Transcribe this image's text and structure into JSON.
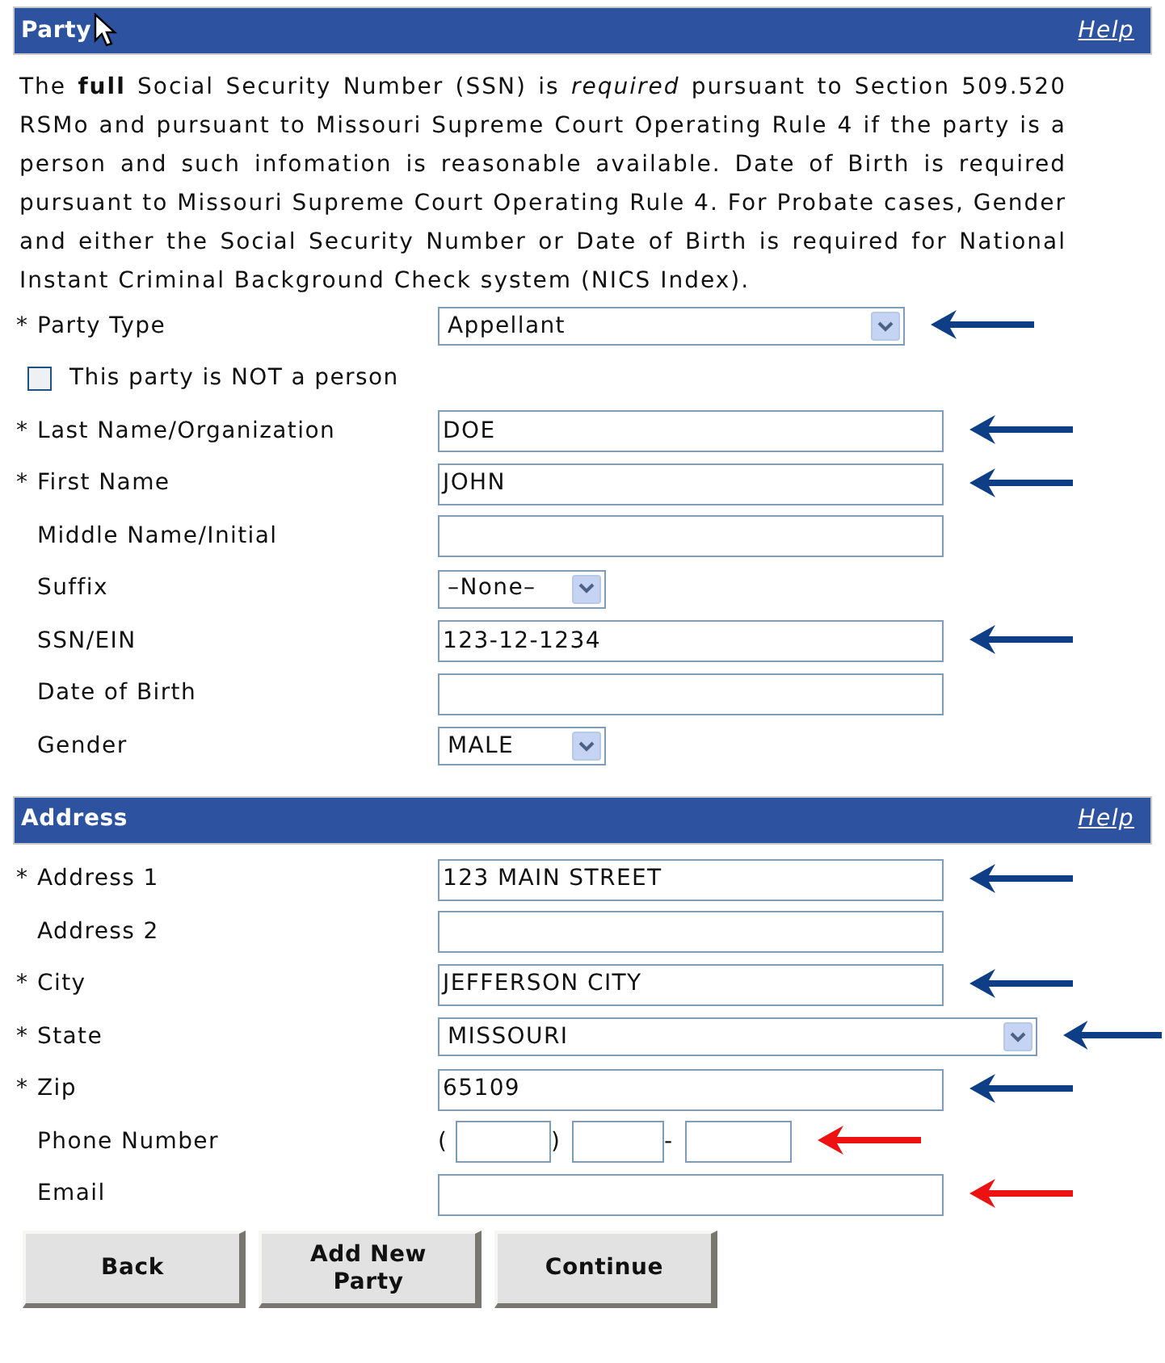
{
  "sections": [
    {
      "title": "Party",
      "help": "Help",
      "cursor": true,
      "intro": "The **full** Social Security Number (SSN) is *required* pursuant to Section 509.520 RSMo and pursuant to Missouri Supreme Court Operating Rule 4 if the party is a person and such infomation is reasonable available. Date of Birth is required pursuant to Missouri Supreme Court Operating Rule 4. For Probate cases, Gender and either the Social Security Number or Date of Birth is required for National Instant Criminal Background Check system (NICS Index).",
      "rows": [
        {
          "kind": "select",
          "marker": "*",
          "label": "Party Type",
          "value": "Appellant",
          "arrow": {
            "color": "#0d3e86"
          }
        },
        {
          "kind": "checkbox",
          "label": "This party is NOT a person",
          "checked": false
        },
        {
          "kind": "text",
          "marker": "*",
          "label": "Last Name/Organization",
          "value": "DOE",
          "arrow": {
            "color": "#0d3e86"
          }
        },
        {
          "kind": "text",
          "marker": "*",
          "label": "First Name",
          "value": "JOHN",
          "arrow": {
            "color": "#0d3e86"
          }
        },
        {
          "kind": "text",
          "label": "Middle Name/Initial"
        },
        {
          "kind": "short-select",
          "label": "Suffix",
          "value": "–None–"
        },
        {
          "kind": "text",
          "label": "SSN/EIN",
          "value": "123-12-1234",
          "arrow": {
            "color": "#0d3e86"
          }
        },
        {
          "kind": "text",
          "label": "Date of Birth"
        },
        {
          "kind": "short-select",
          "label": "Gender",
          "value": "MALE"
        }
      ]
    },
    {
      "title": "Address",
      "help": "Help",
      "cursor": false,
      "rows": [
        {
          "kind": "text",
          "marker": "*",
          "label": "Address 1",
          "value": "123 MAIN STREET",
          "arrow": {
            "color": "#0d3e86"
          }
        },
        {
          "kind": "text",
          "label": "Address 2"
        },
        {
          "kind": "text",
          "marker": "*",
          "label": "City",
          "value": "JEFFERSON CITY",
          "arrow": {
            "color": "#0d3e86"
          }
        },
        {
          "kind": "wide-select",
          "marker": "*",
          "label": "State",
          "value": "MISSOURI",
          "arrow": {
            "color": "#0d3e86"
          }
        },
        {
          "kind": "text",
          "marker": "*",
          "label": "Zip",
          "value": "65109",
          "arrow": {
            "color": "#0d3e86"
          }
        },
        {
          "kind": "phone",
          "label": "Phone Number",
          "open": "(",
          "close": ")",
          "dash": "-",
          "arrow": {
            "color": "#ee1111"
          }
        },
        {
          "kind": "text",
          "label": "Email",
          "arrow": {
            "color": "#ee1111"
          }
        }
      ]
    }
  ],
  "buttons": [
    [
      "Back"
    ],
    [
      "Add New",
      "Party"
    ],
    [
      "Continue"
    ]
  ]
}
